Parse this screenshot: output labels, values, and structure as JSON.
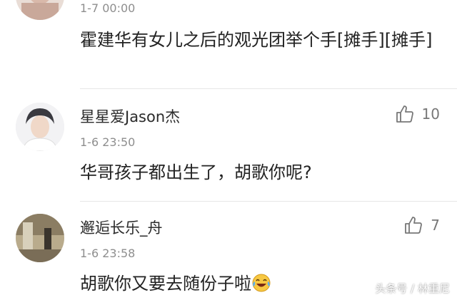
{
  "comments": [
    {
      "time": "1-7 00:00",
      "text": "霍建华有女儿之后的观光团举个手[摊手][摊手]"
    },
    {
      "username": "星星爱Jason杰",
      "time": "1-6 23:50",
      "text": "华哥孩子都出生了，胡歌你呢?",
      "likes": "10"
    },
    {
      "username": "邂逅长乐_舟",
      "time": "1-6 23:58",
      "text": "胡歌你又要去随份子啦",
      "likes": "7"
    }
  ],
  "icons": {
    "like": "thumbs-up-icon",
    "emoji": "laughing-tears-emoji"
  },
  "watermark": "头条号 / 林重尼",
  "colors": {
    "time": "#8e8e8e",
    "divider": "#e6e6e6"
  }
}
